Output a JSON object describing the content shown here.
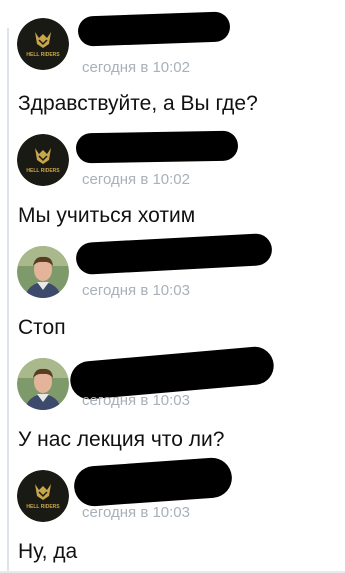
{
  "messages": [
    {
      "avatar": "hell-riders-logo-avatar",
      "time": "сегодня в 10:02",
      "text": "Здравствуйте, а Вы где?"
    },
    {
      "avatar": "hell-riders-logo-avatar",
      "time": "сегодня в 10:02",
      "text": "Мы учиться хотим"
    },
    {
      "avatar": "person-photo-avatar",
      "time": "сегодня в 10:03",
      "text": "Стоп"
    },
    {
      "avatar": "person-photo-avatar",
      "time": "сегодня в 10:03",
      "text": "У нас лекция что ли?"
    },
    {
      "avatar": "hell-riders-logo-avatar",
      "time": "сегодня в 10:03",
      "text": "Ну, да"
    }
  ],
  "logo_text": "HELL RIDERS",
  "colors": {
    "time": "#a8b0ba",
    "text": "#111111",
    "redaction": "#000000",
    "logo_bg": "#1a1a14",
    "logo_gold": "#c9a64a"
  }
}
